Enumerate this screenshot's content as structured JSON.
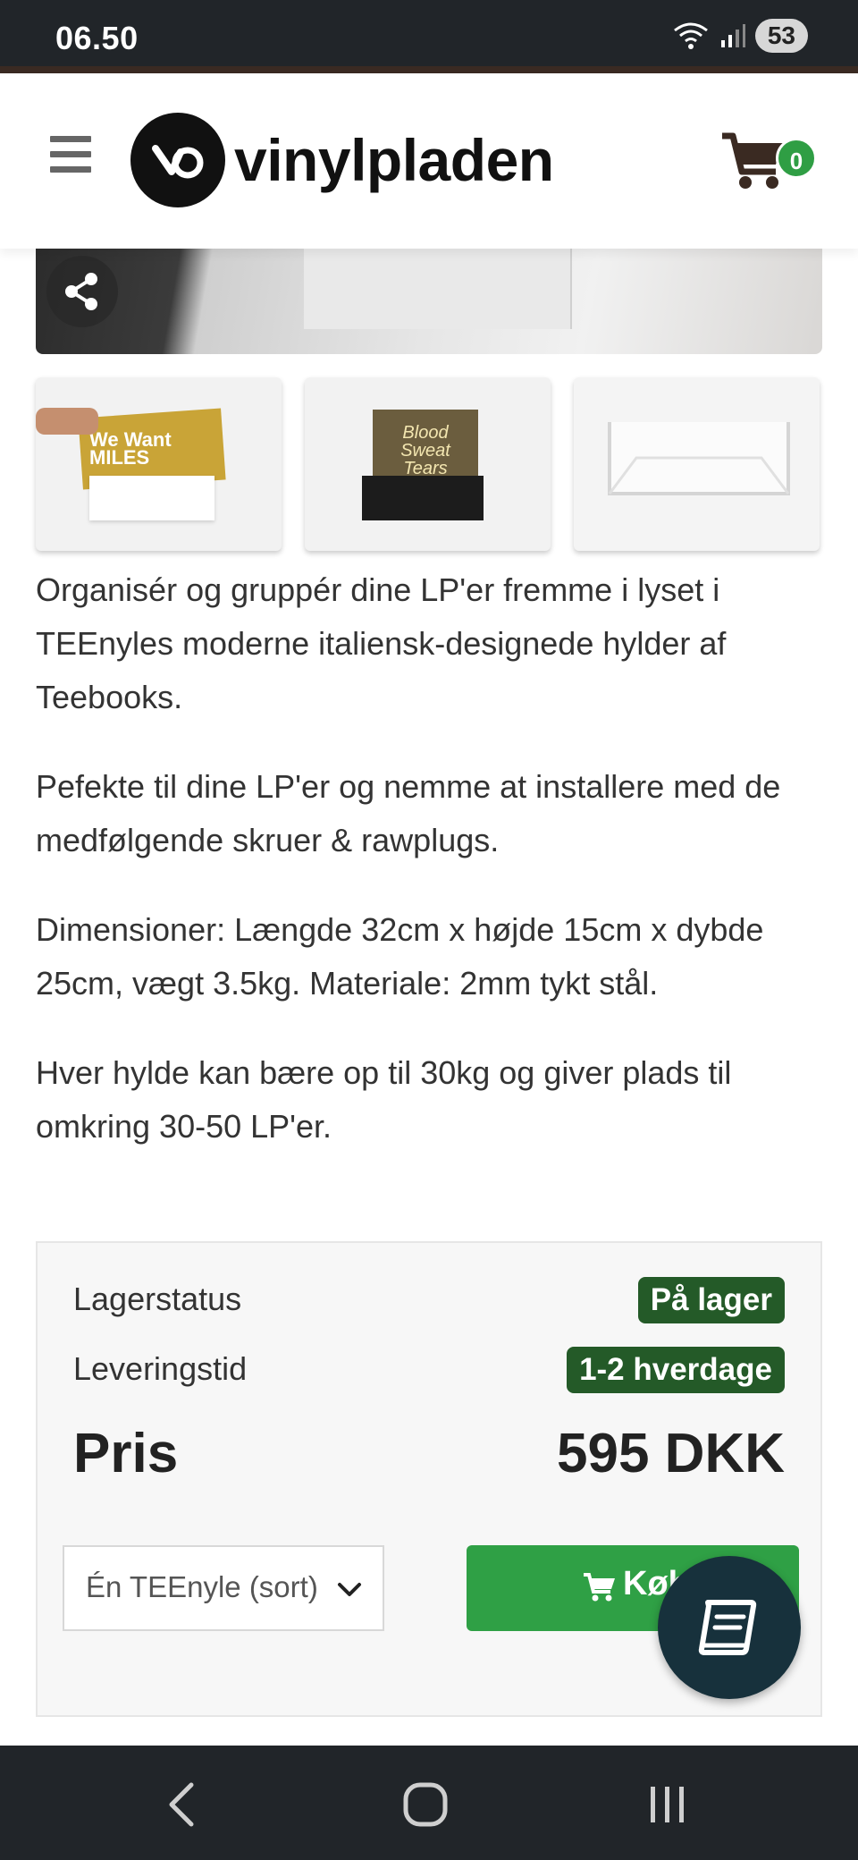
{
  "status_bar": {
    "time": "06.50",
    "battery": "53"
  },
  "header": {
    "logo_text": "vinylpladen",
    "cart_count": "0"
  },
  "gallery": {
    "thumbnails": [
      {
        "label": "We Want MILES"
      },
      {
        "label": "Blood Sweat Tears"
      },
      {
        "label": ""
      }
    ]
  },
  "description": {
    "paragraphs": [
      "Organisér og gruppér dine LP'er fremme i lyset i TEEnyles moderne italiensk-designede hylder af Teebooks.",
      "Pefekte til dine LP'er og nemme at installere med de medfølgende skruer & rawplugs.",
      "Dimensioner: Længde 32cm x højde 15cm x dybde 25cm, vægt 3.5kg. Materiale: 2mm tykt stål.",
      "Hver hylde kan bære op til 30kg og giver plads til omkring 30-50 LP'er."
    ]
  },
  "info": {
    "stock_label": "Lagerstatus",
    "stock_value": "På lager",
    "delivery_label": "Leveringstid",
    "delivery_value": "1-2 hverdage",
    "price_label": "Pris",
    "price_value": "595 DKK",
    "variant_selected": "Én TEEnyle (sort)",
    "buy_label": "Køb"
  },
  "colors": {
    "accent_green": "#2fa045",
    "badge_green": "#245a28",
    "dark": "#212529",
    "float_button": "#17313c"
  }
}
